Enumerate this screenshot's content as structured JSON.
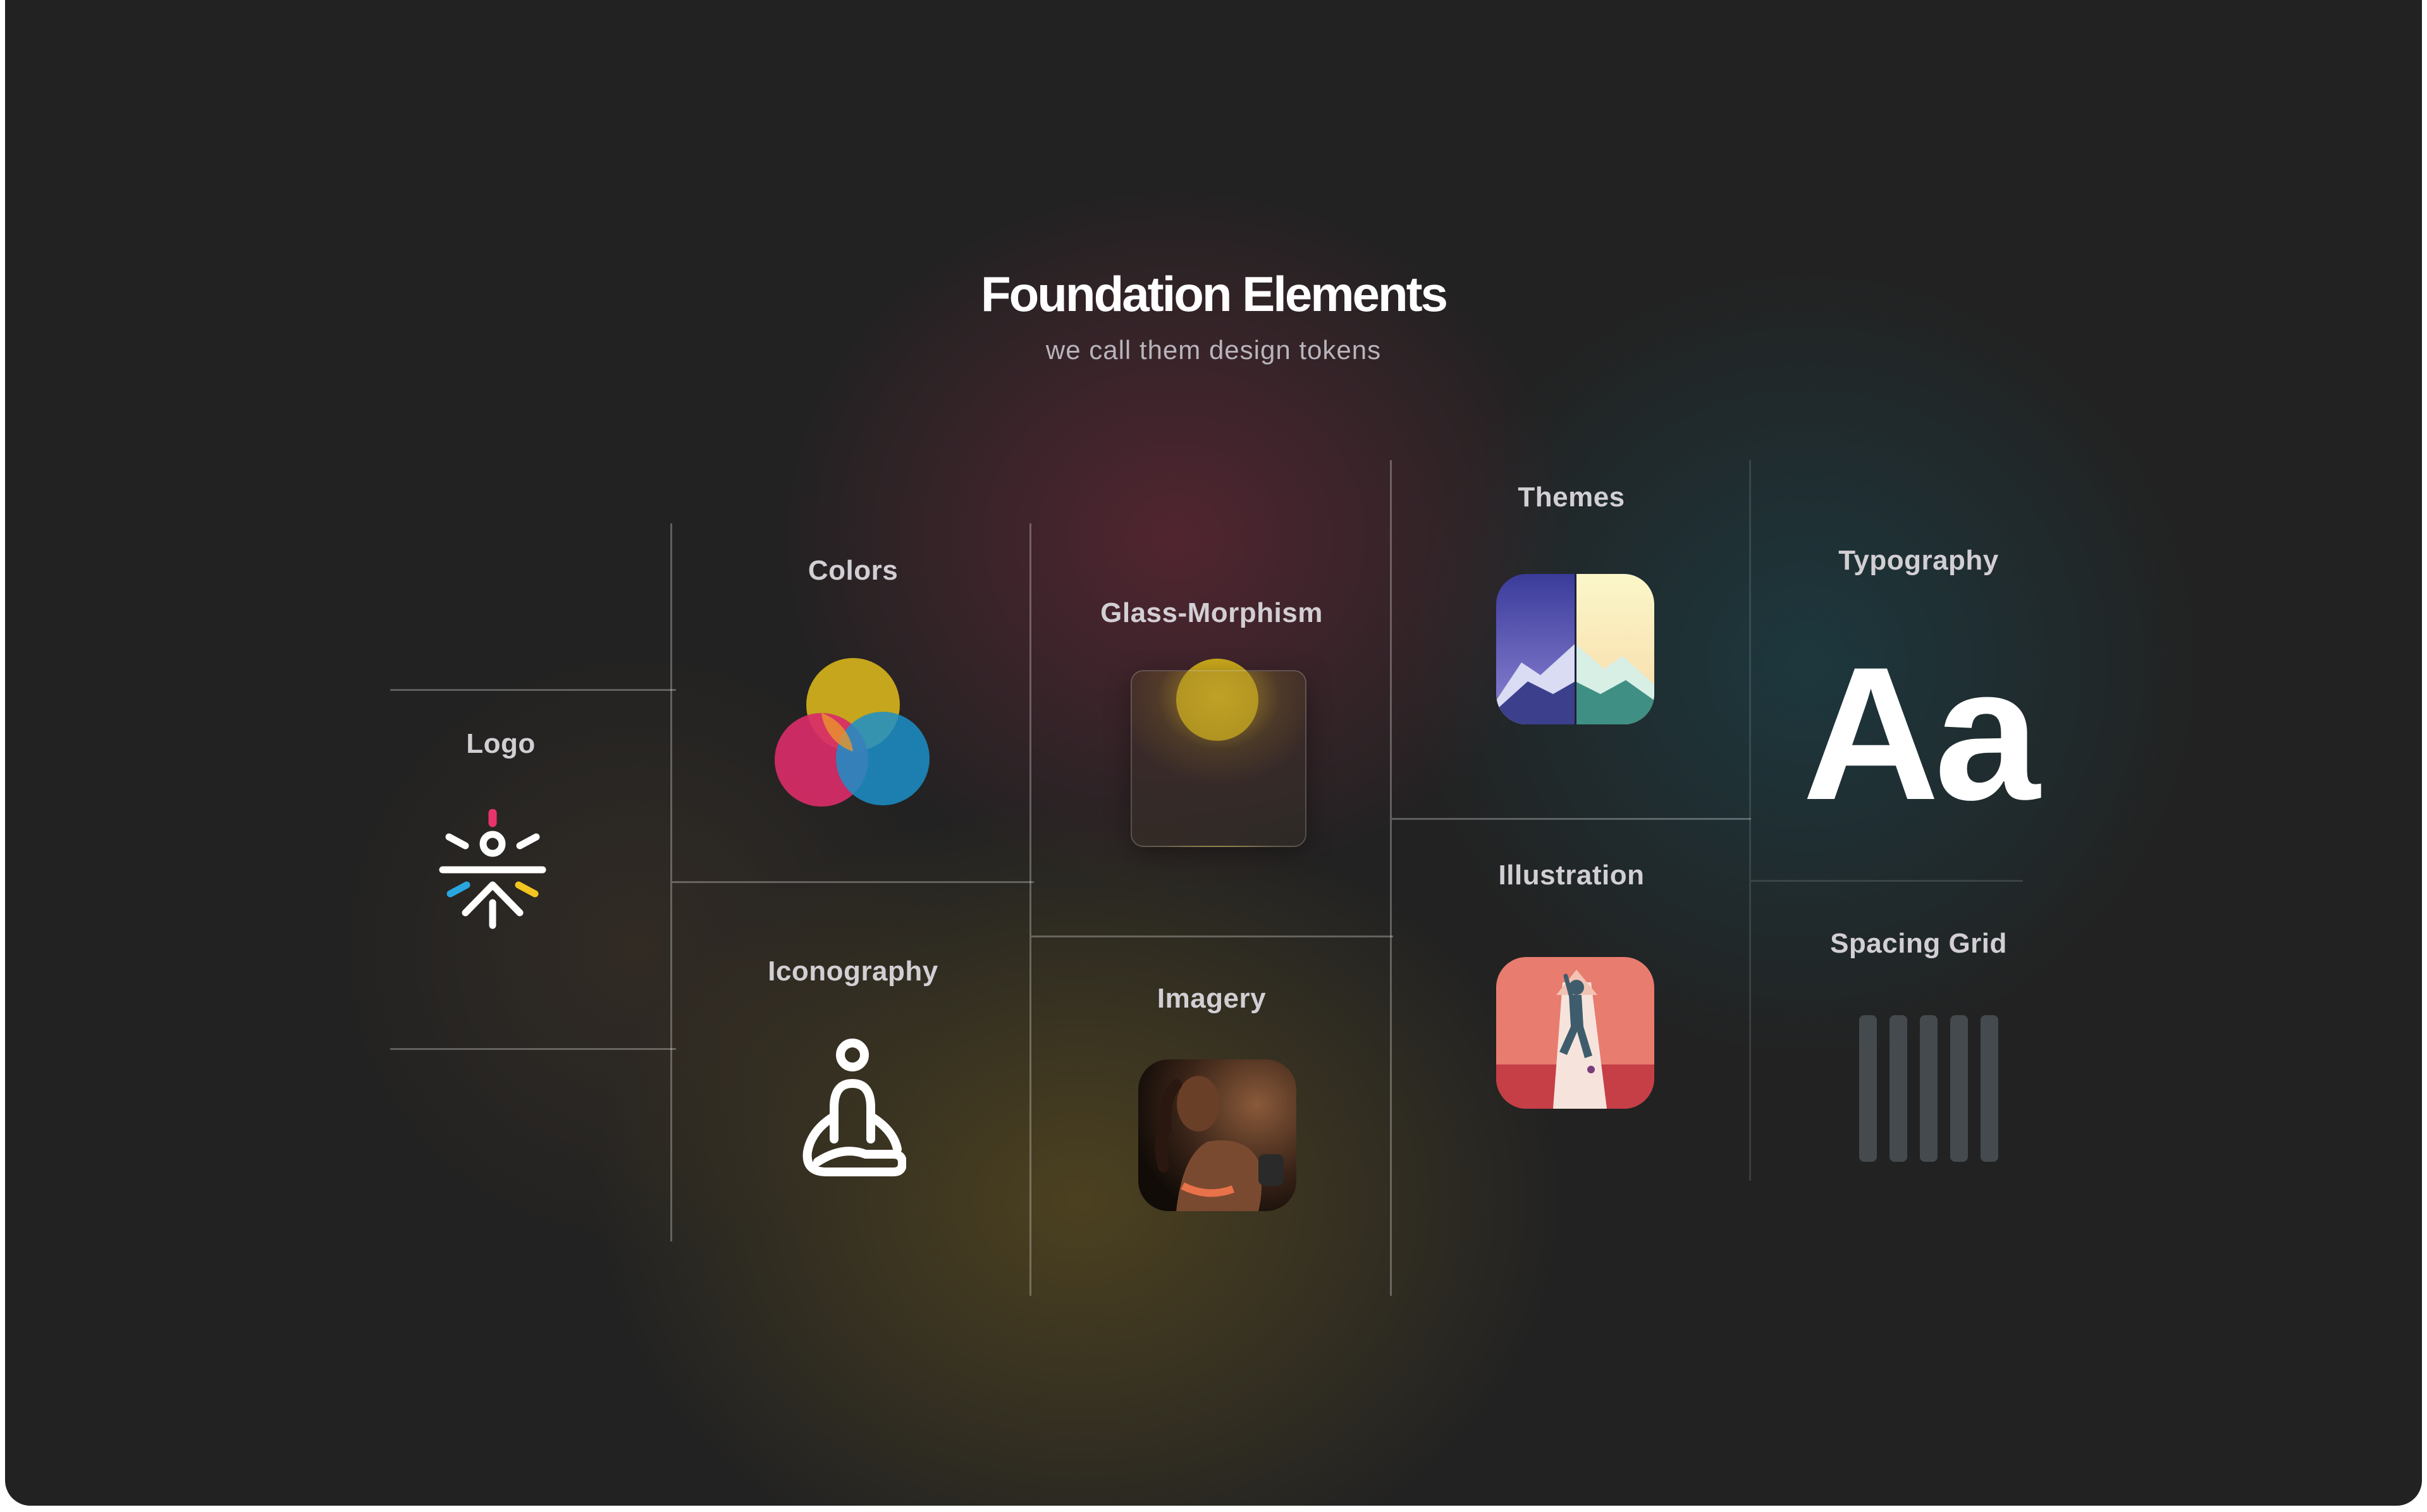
{
  "header": {
    "title": "Foundation Elements",
    "subtitle": "we call them design tokens"
  },
  "sections": {
    "logo": "Logo",
    "colors": "Colors",
    "iconography": "Iconography",
    "glass": "Glass-Morphism",
    "imagery": "Imagery",
    "themes": "Themes",
    "illustration": "Illustration",
    "typography": "Typography",
    "spacing": "Spacing Grid"
  },
  "typography_sample": "Aa",
  "icons": {
    "logo": "sun-person-logo-icon",
    "iconography": "meditation-icon"
  },
  "colors": {
    "yellow": "#d4b21c",
    "pink": "#d82d68",
    "blue": "#1b8fc9",
    "logo_pink": "#e8336e",
    "logo_blue": "#2aa6df",
    "logo_yellow": "#f2c521",
    "background": "#222222"
  }
}
